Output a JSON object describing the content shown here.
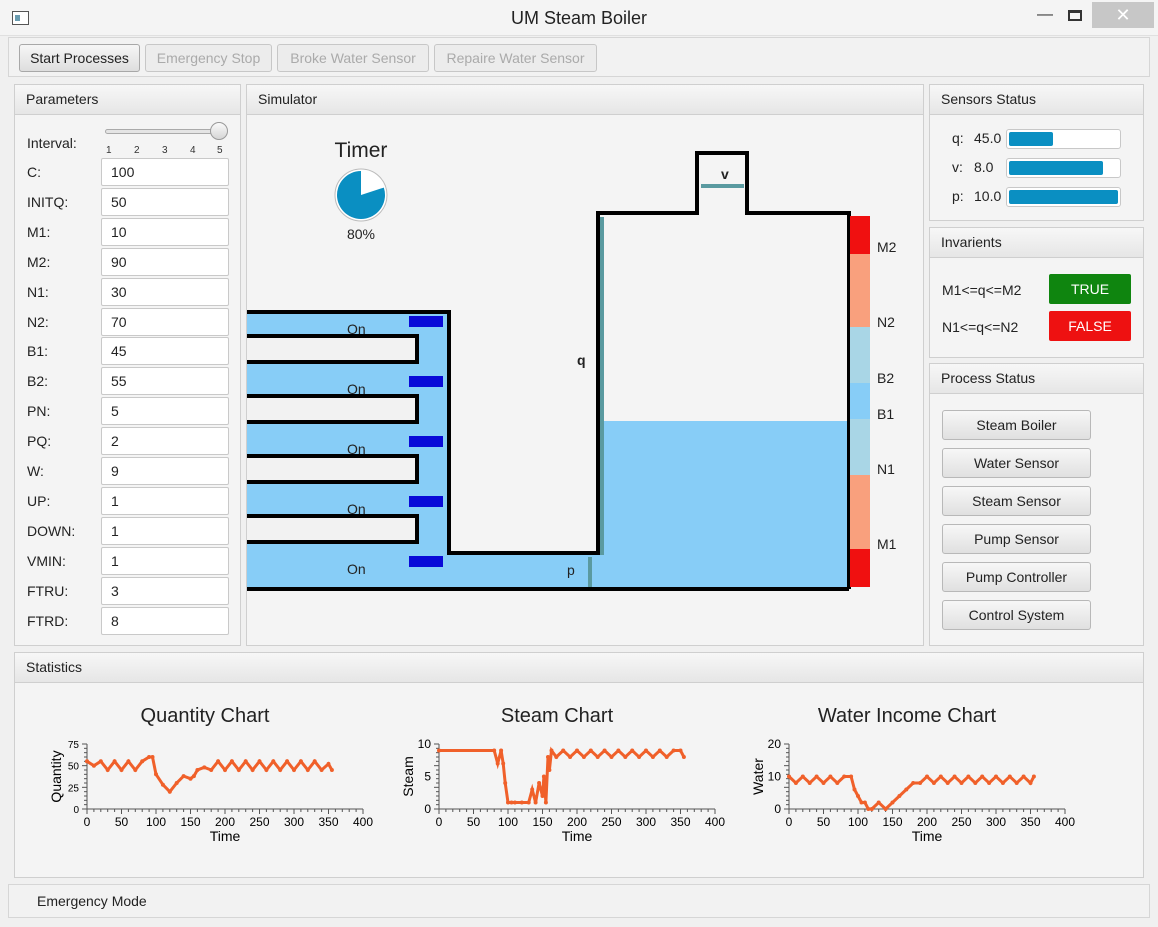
{
  "window": {
    "title": "UM Steam Boiler",
    "maximize_icon": "maximize-icon",
    "minimize_icon": "minimize-icon",
    "close_icon": "close-icon"
  },
  "toolbar": {
    "start": "Start Processes",
    "emergency": "Emergency Stop",
    "broke": "Broke Water Sensor",
    "repair": "Repaire Water Sensor"
  },
  "parameters": {
    "title": "Parameters",
    "interval_label": "Interval:",
    "interval_ticks": [
      "1",
      "2",
      "3",
      "4",
      "5"
    ],
    "interval_value": 5,
    "fields": [
      {
        "label": "C:",
        "value": "100"
      },
      {
        "label": "INITQ:",
        "value": "50"
      },
      {
        "label": "M1:",
        "value": "10"
      },
      {
        "label": "M2:",
        "value": "90"
      },
      {
        "label": "N1:",
        "value": "30"
      },
      {
        "label": "N2:",
        "value": "70"
      },
      {
        "label": "B1:",
        "value": "45"
      },
      {
        "label": "B2:",
        "value": "55"
      },
      {
        "label": "PN:",
        "value": "5"
      },
      {
        "label": "PQ:",
        "value": "2"
      },
      {
        "label": "W:",
        "value": "9"
      },
      {
        "label": "UP:",
        "value": "1"
      },
      {
        "label": "DOWN:",
        "value": "1"
      },
      {
        "label": "VMIN:",
        "value": "1"
      },
      {
        "label": "FTRU:",
        "value": "3"
      },
      {
        "label": "FTRD:",
        "value": "8"
      }
    ]
  },
  "simulator": {
    "title": "Simulator",
    "timer_label": "Timer",
    "timer_percent": "80%",
    "timer_fraction": 0.8,
    "pumps": [
      "On",
      "On",
      "On",
      "On",
      "On"
    ],
    "labels": {
      "q": "q",
      "v": "v",
      "p": "p"
    },
    "levels": [
      "M2",
      "N2",
      "B2",
      "B1",
      "N1",
      "M1"
    ],
    "water_fraction": 0.45
  },
  "sensors": {
    "title": "Sensors Status",
    "items": [
      {
        "name": "q:",
        "value": "45.0",
        "fraction": 0.4
      },
      {
        "name": "v:",
        "value": "8.0",
        "fraction": 0.86
      },
      {
        "name": "p:",
        "value": "10.0",
        "fraction": 1.0
      }
    ]
  },
  "invariants": {
    "title": "Invarients",
    "items": [
      {
        "expr": "M1<=q<=M2",
        "result": "TRUE",
        "color": "#0f850f"
      },
      {
        "expr": "N1<=q<=N2",
        "result": "FALSE",
        "color": "#ee1111"
      }
    ]
  },
  "process": {
    "title": "Process Status",
    "buttons": [
      "Steam Boiler",
      "Water Sensor",
      "Steam Sensor",
      "Pump Sensor",
      "Pump Controller",
      "Control System"
    ]
  },
  "statistics": {
    "title": "Statistics"
  },
  "colors": {
    "series": "#f0602a",
    "water": "#87cdf7",
    "pump": "#0a0ad8",
    "sensor": "#0a8fc2"
  },
  "chart_data": [
    {
      "type": "line",
      "title": "Quantity Chart",
      "xlabel": "Time",
      "ylabel": "Quantity",
      "xlim": [
        0,
        400
      ],
      "ylim": [
        0,
        75
      ],
      "xticks": [
        "0",
        "50",
        "100",
        "150",
        "200",
        "250",
        "300",
        "350",
        "400"
      ],
      "yticks": [
        "0",
        "25",
        "50",
        "75"
      ],
      "x": [
        0,
        10,
        20,
        30,
        40,
        50,
        60,
        70,
        80,
        90,
        95,
        100,
        110,
        120,
        130,
        140,
        150,
        155,
        160,
        170,
        180,
        190,
        200,
        210,
        220,
        230,
        240,
        250,
        260,
        270,
        280,
        290,
        300,
        310,
        320,
        330,
        340,
        350,
        355
      ],
      "values": [
        55,
        50,
        55,
        45,
        55,
        45,
        55,
        45,
        55,
        60,
        60,
        40,
        28,
        20,
        30,
        38,
        35,
        38,
        45,
        48,
        45,
        55,
        45,
        55,
        45,
        55,
        45,
        55,
        45,
        55,
        45,
        55,
        45,
        55,
        45,
        55,
        45,
        52,
        45
      ]
    },
    {
      "type": "line",
      "title": "Steam Chart",
      "xlabel": "Time",
      "ylabel": "Steam",
      "xlim": [
        0,
        400
      ],
      "ylim": [
        0,
        10
      ],
      "xticks": [
        "0",
        "50",
        "100",
        "150",
        "200",
        "250",
        "300",
        "350",
        "400"
      ],
      "yticks": [
        "0",
        "5",
        "10"
      ],
      "x": [
        0,
        80,
        85,
        90,
        93,
        96,
        100,
        105,
        110,
        120,
        130,
        135,
        140,
        145,
        150,
        152,
        155,
        158,
        160,
        163,
        170,
        180,
        190,
        200,
        210,
        220,
        230,
        240,
        250,
        260,
        270,
        280,
        290,
        300,
        310,
        320,
        330,
        340,
        350,
        355
      ],
      "values": [
        9,
        9,
        7,
        9,
        7,
        4,
        1,
        1,
        1,
        1,
        1,
        3,
        1,
        4,
        2,
        5,
        1,
        8,
        6,
        9,
        8,
        9,
        8,
        9,
        8,
        9,
        8,
        9,
        8,
        9,
        8,
        9,
        8,
        9,
        8,
        9,
        8,
        9,
        9,
        8
      ]
    },
    {
      "type": "line",
      "title": "Water Income Chart",
      "xlabel": "Time",
      "ylabel": "Water",
      "xlim": [
        0,
        400
      ],
      "ylim": [
        0,
        20
      ],
      "xticks": [
        "0",
        "50",
        "100",
        "150",
        "200",
        "250",
        "300",
        "350",
        "400"
      ],
      "yticks": [
        "0",
        "10",
        "20"
      ],
      "x": [
        0,
        10,
        20,
        30,
        40,
        50,
        60,
        70,
        80,
        90,
        95,
        100,
        105,
        110,
        115,
        120,
        130,
        140,
        150,
        160,
        170,
        180,
        190,
        200,
        210,
        220,
        230,
        240,
        250,
        260,
        270,
        280,
        290,
        300,
        310,
        320,
        330,
        340,
        350,
        355
      ],
      "values": [
        10,
        8,
        10,
        8,
        10,
        8,
        10,
        8,
        10,
        10,
        6,
        4,
        2,
        2,
        0,
        0,
        2,
        0,
        2,
        4,
        6,
        8,
        8,
        10,
        8,
        10,
        8,
        10,
        8,
        10,
        8,
        10,
        8,
        10,
        8,
        10,
        8,
        10,
        8,
        10
      ]
    }
  ],
  "status_bar": {
    "text": "Emergency Mode"
  }
}
